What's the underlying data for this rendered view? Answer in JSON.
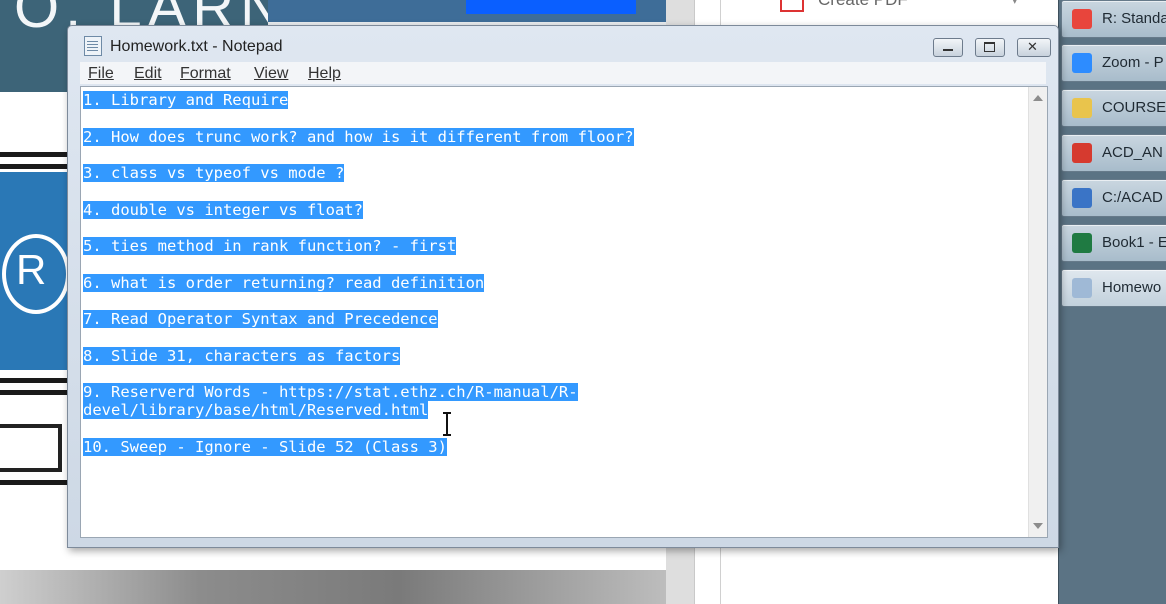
{
  "background": {
    "banner_text": "O. LARN",
    "create_pdf_label": "Create PDF"
  },
  "taskbar": {
    "items": [
      {
        "label": "R: Standa",
        "icon": "chrome-icon",
        "color": "#e8453c"
      },
      {
        "label": "Zoom - P",
        "icon": "zoom-icon",
        "color": "#2d8cff"
      },
      {
        "label": "COURSE",
        "icon": "folder-icon",
        "color": "#e9c44c"
      },
      {
        "label": "ACD_AN",
        "icon": "pdf-icon",
        "color": "#d63a2f"
      },
      {
        "label": "C:/ACAD",
        "icon": "r-icon",
        "color": "#3a74c6"
      },
      {
        "label": "Book1 - E",
        "icon": "excel-icon",
        "color": "#1f7a42"
      },
      {
        "label": "Homewo",
        "icon": "notepad-icon",
        "color": "#9fb9d6"
      }
    ]
  },
  "window": {
    "title": "Homework.txt - Notepad",
    "controls": {
      "minimize": "minimize",
      "maximize": "maximize",
      "close": "close"
    }
  },
  "menu": {
    "items": [
      {
        "label": "File",
        "underline": "F",
        "rest": "ile"
      },
      {
        "label": "Edit",
        "underline": "E",
        "rest": "dit"
      },
      {
        "label": "Format",
        "underline": "o",
        "pre": "F",
        "rest": "rmat"
      },
      {
        "label": "View",
        "underline": "V",
        "rest": "iew"
      },
      {
        "label": "Help",
        "underline": "H",
        "rest": "elp"
      }
    ]
  },
  "document": {
    "lines": [
      "1. Library and Require",
      "2. How does trunc work? and how is it different from floor?",
      "3. class vs typeof vs mode ?",
      "4. double vs integer vs float?",
      "5. ties method in rank function? - first",
      "6. what is order returning? read definition",
      "7. Read Operator Syntax and Precedence",
      "8. Slide 31, characters as factors",
      "9. Reserverd Words - https://stat.ethz.ch/R-manual/R-",
      "devel/library/base/html/Reserved.html",
      "10. Sweep - Ignore - Slide 52 (Class 3)"
    ]
  },
  "colors": {
    "selection": "#3399ff",
    "taskbar": "#5b7384"
  }
}
